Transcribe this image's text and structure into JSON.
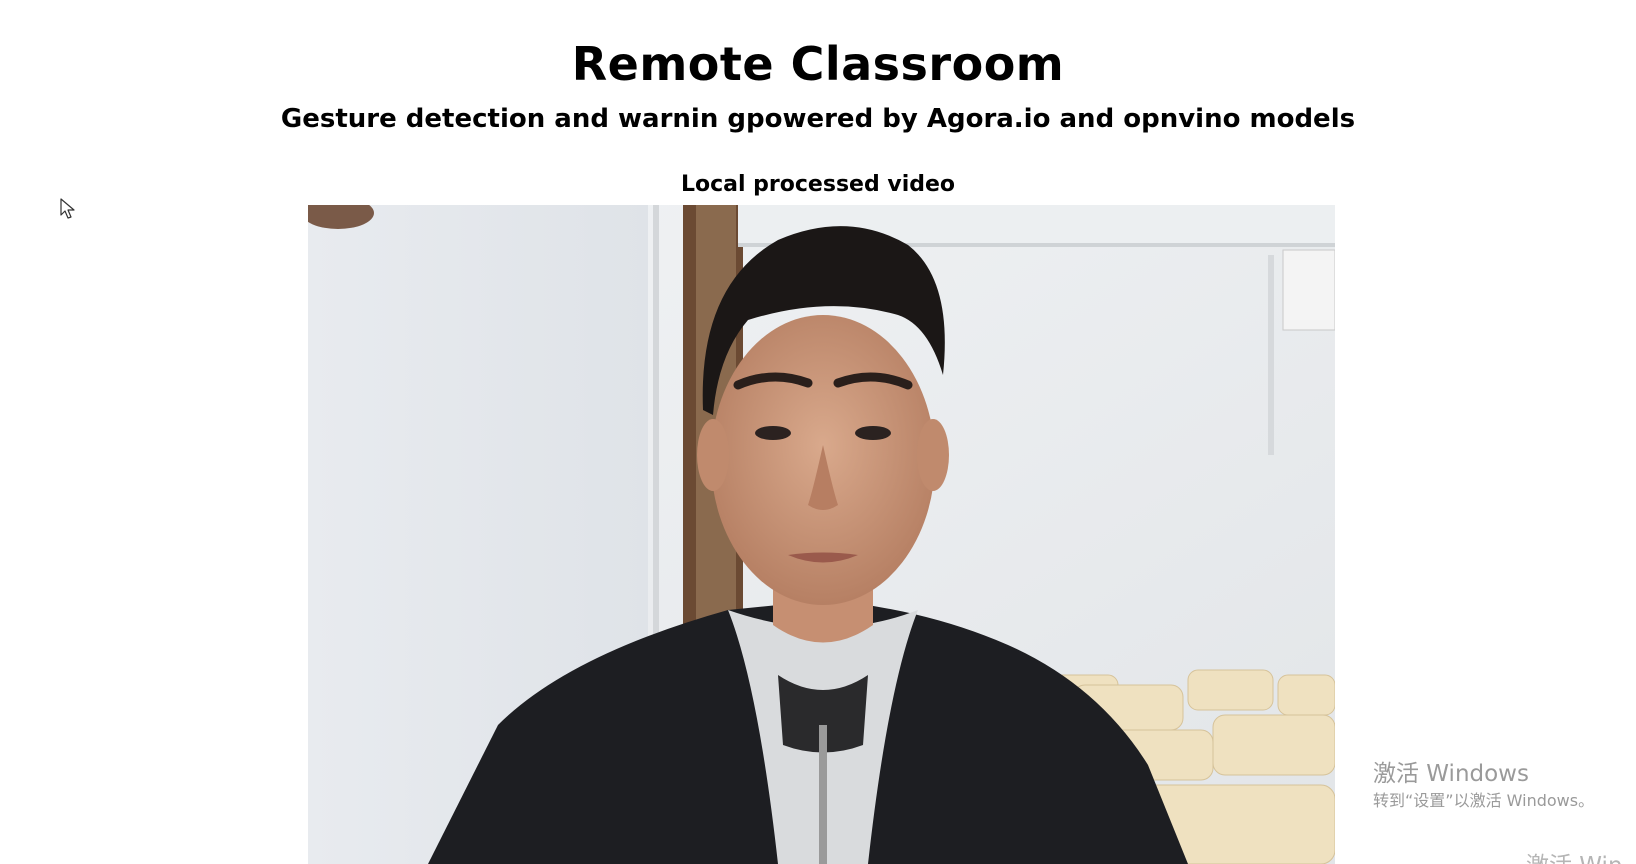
{
  "header": {
    "title": "Remote Classroom",
    "subtitle": "Gesture detection and warnin gpowered by Agora.io and opnvino models"
  },
  "video": {
    "label": "Local processed video"
  },
  "os_overlay": {
    "activation_title": "激活 Windows",
    "activation_hint": "转到“设置”以激活 Windows。",
    "activation_title_partial": "激活 Win"
  },
  "icons": {
    "cursor": "mouse-pointer-icon"
  }
}
